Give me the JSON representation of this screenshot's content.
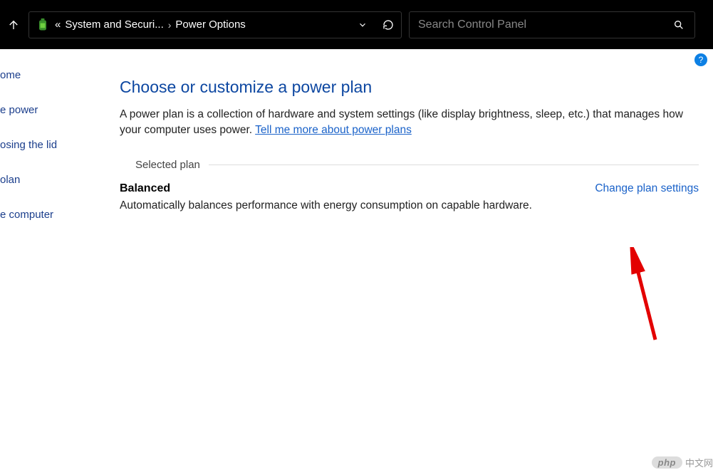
{
  "breadcrumb": {
    "prefix": "«",
    "part1": "System and Securi...",
    "sep": "›",
    "part2": "Power Options"
  },
  "search_placeholder": "Search Control Panel",
  "sidebar": {
    "items": [
      "ome",
      "e power",
      "osing the lid",
      "olan",
      "e computer"
    ]
  },
  "page_title": "Choose or customize a power plan",
  "description_pre": "A power plan is a collection of hardware and system settings (like display brightness, sleep, etc.) that manages how your computer uses power. ",
  "description_link": "Tell me more about power plans",
  "section_label": "Selected plan",
  "plan": {
    "name": "Balanced",
    "desc": "Automatically balances performance with energy consumption on capable hardware.",
    "change_link": "Change plan settings"
  },
  "help_text": "?",
  "watermark": {
    "badge": "php",
    "text": "中文网"
  }
}
